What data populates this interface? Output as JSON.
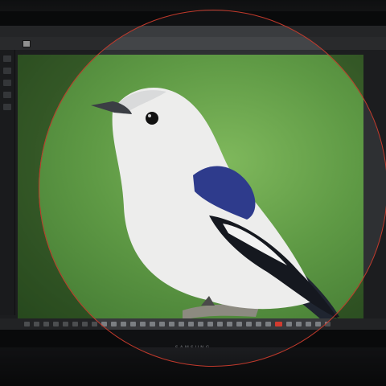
{
  "menu": {
    "items": [
      "",
      "",
      ""
    ]
  },
  "options": {
    "items": [
      "",
      ""
    ]
  },
  "brand": "SAMSUNG",
  "colors": {
    "canvas_bg": "#5f9a45",
    "lens_ring": "#c0392b",
    "bird_body": "#eeeeee",
    "bird_wing": "#2f3c8a"
  },
  "icons": [
    "move-tool-icon",
    "selection-tool-icon",
    "brush-tool-icon",
    "eraser-tool-icon",
    "zoom-tool-icon"
  ]
}
